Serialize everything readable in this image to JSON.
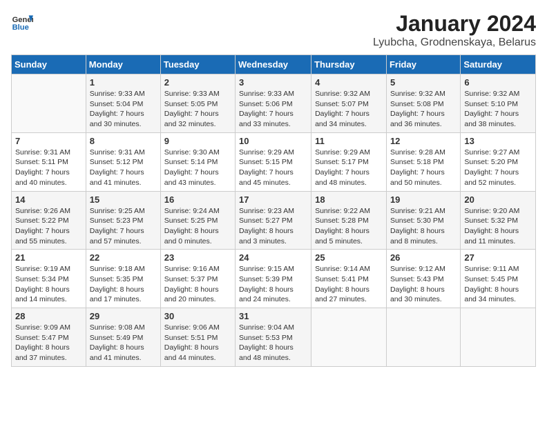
{
  "header": {
    "logo_line1": "General",
    "logo_line2": "Blue",
    "title": "January 2024",
    "subtitle": "Lyubcha, Grodnenskaya, Belarus"
  },
  "calendar": {
    "days_of_week": [
      "Sunday",
      "Monday",
      "Tuesday",
      "Wednesday",
      "Thursday",
      "Friday",
      "Saturday"
    ],
    "weeks": [
      [
        {
          "day": "",
          "info": ""
        },
        {
          "day": "1",
          "info": "Sunrise: 9:33 AM\nSunset: 5:04 PM\nDaylight: 7 hours\nand 30 minutes."
        },
        {
          "day": "2",
          "info": "Sunrise: 9:33 AM\nSunset: 5:05 PM\nDaylight: 7 hours\nand 32 minutes."
        },
        {
          "day": "3",
          "info": "Sunrise: 9:33 AM\nSunset: 5:06 PM\nDaylight: 7 hours\nand 33 minutes."
        },
        {
          "day": "4",
          "info": "Sunrise: 9:32 AM\nSunset: 5:07 PM\nDaylight: 7 hours\nand 34 minutes."
        },
        {
          "day": "5",
          "info": "Sunrise: 9:32 AM\nSunset: 5:08 PM\nDaylight: 7 hours\nand 36 minutes."
        },
        {
          "day": "6",
          "info": "Sunrise: 9:32 AM\nSunset: 5:10 PM\nDaylight: 7 hours\nand 38 minutes."
        }
      ],
      [
        {
          "day": "7",
          "info": "Sunrise: 9:31 AM\nSunset: 5:11 PM\nDaylight: 7 hours\nand 40 minutes."
        },
        {
          "day": "8",
          "info": "Sunrise: 9:31 AM\nSunset: 5:12 PM\nDaylight: 7 hours\nand 41 minutes."
        },
        {
          "day": "9",
          "info": "Sunrise: 9:30 AM\nSunset: 5:14 PM\nDaylight: 7 hours\nand 43 minutes."
        },
        {
          "day": "10",
          "info": "Sunrise: 9:29 AM\nSunset: 5:15 PM\nDaylight: 7 hours\nand 45 minutes."
        },
        {
          "day": "11",
          "info": "Sunrise: 9:29 AM\nSunset: 5:17 PM\nDaylight: 7 hours\nand 48 minutes."
        },
        {
          "day": "12",
          "info": "Sunrise: 9:28 AM\nSunset: 5:18 PM\nDaylight: 7 hours\nand 50 minutes."
        },
        {
          "day": "13",
          "info": "Sunrise: 9:27 AM\nSunset: 5:20 PM\nDaylight: 7 hours\nand 52 minutes."
        }
      ],
      [
        {
          "day": "14",
          "info": "Sunrise: 9:26 AM\nSunset: 5:22 PM\nDaylight: 7 hours\nand 55 minutes."
        },
        {
          "day": "15",
          "info": "Sunrise: 9:25 AM\nSunset: 5:23 PM\nDaylight: 7 hours\nand 57 minutes."
        },
        {
          "day": "16",
          "info": "Sunrise: 9:24 AM\nSunset: 5:25 PM\nDaylight: 8 hours\nand 0 minutes."
        },
        {
          "day": "17",
          "info": "Sunrise: 9:23 AM\nSunset: 5:27 PM\nDaylight: 8 hours\nand 3 minutes."
        },
        {
          "day": "18",
          "info": "Sunrise: 9:22 AM\nSunset: 5:28 PM\nDaylight: 8 hours\nand 5 minutes."
        },
        {
          "day": "19",
          "info": "Sunrise: 9:21 AM\nSunset: 5:30 PM\nDaylight: 8 hours\nand 8 minutes."
        },
        {
          "day": "20",
          "info": "Sunrise: 9:20 AM\nSunset: 5:32 PM\nDaylight: 8 hours\nand 11 minutes."
        }
      ],
      [
        {
          "day": "21",
          "info": "Sunrise: 9:19 AM\nSunset: 5:34 PM\nDaylight: 8 hours\nand 14 minutes."
        },
        {
          "day": "22",
          "info": "Sunrise: 9:18 AM\nSunset: 5:35 PM\nDaylight: 8 hours\nand 17 minutes."
        },
        {
          "day": "23",
          "info": "Sunrise: 9:16 AM\nSunset: 5:37 PM\nDaylight: 8 hours\nand 20 minutes."
        },
        {
          "day": "24",
          "info": "Sunrise: 9:15 AM\nSunset: 5:39 PM\nDaylight: 8 hours\nand 24 minutes."
        },
        {
          "day": "25",
          "info": "Sunrise: 9:14 AM\nSunset: 5:41 PM\nDaylight: 8 hours\nand 27 minutes."
        },
        {
          "day": "26",
          "info": "Sunrise: 9:12 AM\nSunset: 5:43 PM\nDaylight: 8 hours\nand 30 minutes."
        },
        {
          "day": "27",
          "info": "Sunrise: 9:11 AM\nSunset: 5:45 PM\nDaylight: 8 hours\nand 34 minutes."
        }
      ],
      [
        {
          "day": "28",
          "info": "Sunrise: 9:09 AM\nSunset: 5:47 PM\nDaylight: 8 hours\nand 37 minutes."
        },
        {
          "day": "29",
          "info": "Sunrise: 9:08 AM\nSunset: 5:49 PM\nDaylight: 8 hours\nand 41 minutes."
        },
        {
          "day": "30",
          "info": "Sunrise: 9:06 AM\nSunset: 5:51 PM\nDaylight: 8 hours\nand 44 minutes."
        },
        {
          "day": "31",
          "info": "Sunrise: 9:04 AM\nSunset: 5:53 PM\nDaylight: 8 hours\nand 48 minutes."
        },
        {
          "day": "",
          "info": ""
        },
        {
          "day": "",
          "info": ""
        },
        {
          "day": "",
          "info": ""
        }
      ]
    ]
  }
}
